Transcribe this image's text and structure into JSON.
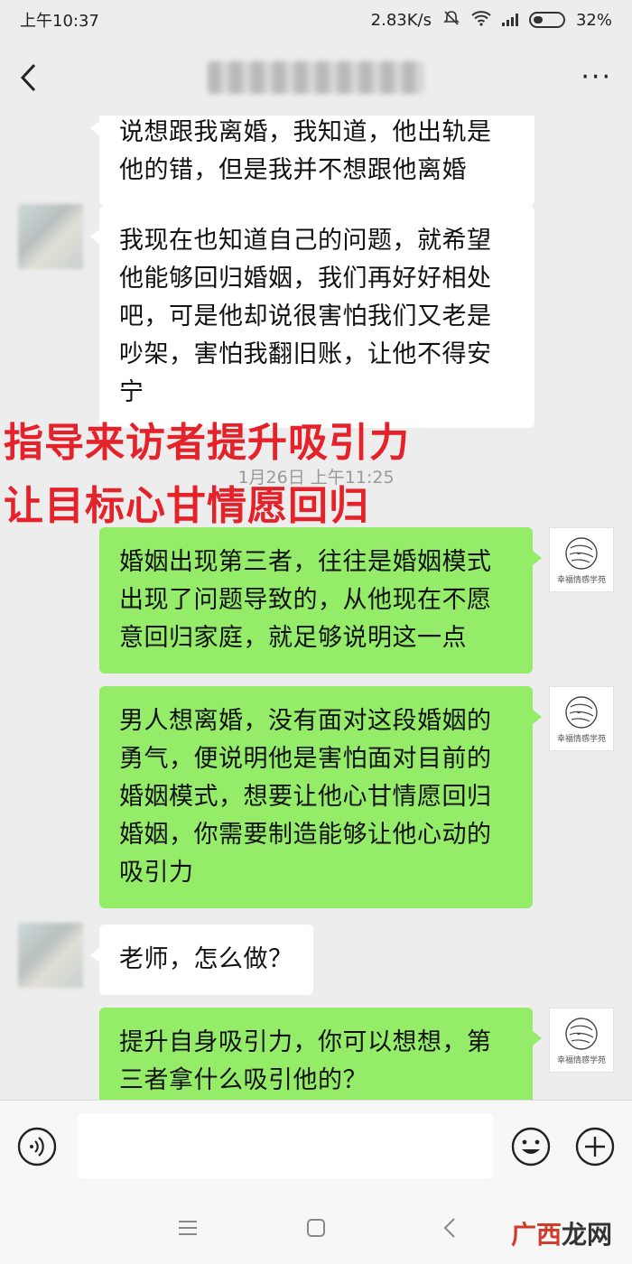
{
  "status_bar": {
    "time": "上午10:37",
    "speed": "2.83K/s",
    "battery": "32%"
  },
  "nav": {
    "title": "████████"
  },
  "messages": [
    {
      "side": "left",
      "text": "说想跟我离婚，我知道，他出轨是他的错，但是我并不想跟他离婚"
    },
    {
      "side": "left",
      "text": "我现在也知道自己的问题，就希望他能够回归婚姻，我们再好好相处吧，可是他却说很害怕我们又老是吵架，害怕我翻旧账，让他不得安宁"
    },
    {
      "side": "right",
      "text": "婚姻出现第三者，往往是婚姻模式出现了问题导致的，从他现在不愿意回归家庭，就足够说明这一点"
    },
    {
      "side": "right",
      "text": "男人想离婚，没有面对这段婚姻的勇气，便说明他是害怕面对目前的婚姻模式，想要让他心甘情愿回归婚姻，你需要制造能够让他心动的吸引力"
    },
    {
      "side": "left",
      "text": "老师，怎么做？"
    },
    {
      "side": "right",
      "text": "提升自身吸引力，你可以想想，第三者拿什么吸引他的？"
    }
  ],
  "timestamp": "1月26日 上午11:25",
  "overlay": {
    "line1": "指导来访者提升吸引力",
    "line2": "让目标心甘情愿回归"
  },
  "avatar_logo": {
    "caption": "幸福情感学苑"
  },
  "input": {
    "value": ""
  },
  "watermark": {
    "part1": "广西",
    "part2": "龙网"
  },
  "colors": {
    "green_bubble": "#95ec69",
    "overlay_red": "#e5212a"
  }
}
